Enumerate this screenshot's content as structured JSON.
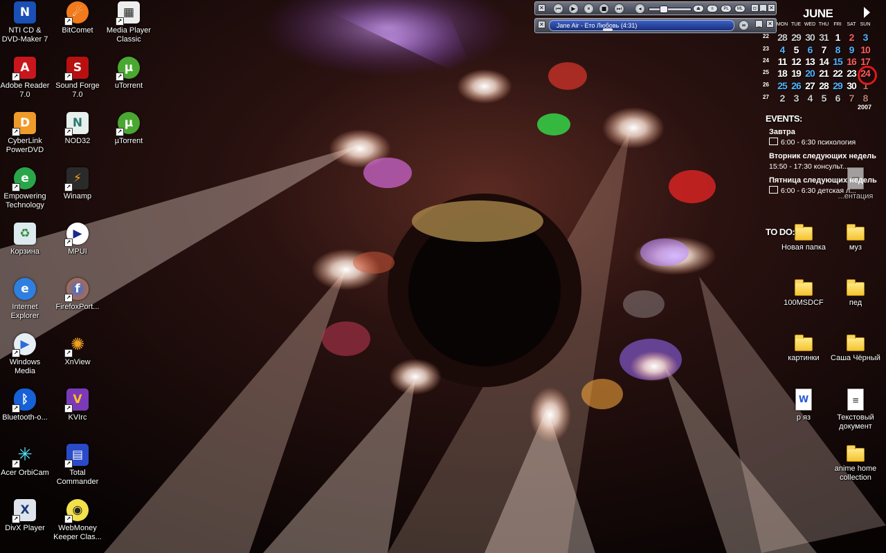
{
  "desktop": {
    "icons_left": [
      {
        "label": "NTI CD & DVD-Maker 7",
        "icon": "nti-icon"
      },
      {
        "label": "Adobe Reader 7.0",
        "icon": "adobe-reader-icon"
      },
      {
        "label": "CyberLink PowerDVD",
        "icon": "powerdvd-icon"
      },
      {
        "label": "Empowering Technology",
        "icon": "empowering-icon"
      },
      {
        "label": "Корзина",
        "icon": "recycle-bin-icon"
      },
      {
        "label": "Internet Explorer",
        "icon": "internet-explorer-icon"
      },
      {
        "label": "Windows Media",
        "icon": "windows-media-icon"
      },
      {
        "label": "Bluetooth-о...",
        "icon": "bluetooth-icon"
      },
      {
        "label": "Acer OrbiCam",
        "icon": "orbicam-icon"
      },
      {
        "label": "DivX Player",
        "icon": "divx-icon"
      }
    ],
    "icons_mid": [
      {
        "label": "BitComet",
        "icon": "bitcomet-icon"
      },
      {
        "label": "Sound Forge 7.0",
        "icon": "sound-forge-icon"
      },
      {
        "label": "NOD32",
        "icon": "nod32-icon"
      },
      {
        "label": "Winamp",
        "icon": "winamp-icon"
      },
      {
        "label": "MPUI",
        "icon": "mpui-icon"
      },
      {
        "label": "FirefoxPort...",
        "icon": "firefox-icon"
      },
      {
        "label": "XnView",
        "icon": "xnview-icon"
      },
      {
        "label": "KVIrc",
        "icon": "kvirc-icon"
      },
      {
        "label": "Total Commander",
        "icon": "total-commander-icon"
      },
      {
        "label": "WebMoney Keeper Clas...",
        "icon": "webmoney-icon"
      }
    ],
    "icons_third": [
      {
        "label": "Media Player Classic",
        "icon": "media-player-classic-icon"
      },
      {
        "label": "uTorrent",
        "icon": "utorrent-icon"
      },
      {
        "label": "µTorrent",
        "icon": "utorrent-icon"
      }
    ],
    "icons_right": [
      {
        "label": "Новая папка",
        "icon": "folder-icon"
      },
      {
        "label": "муз",
        "icon": "folder-icon"
      },
      {
        "label": "100MSDCF",
        "icon": "folder-icon"
      },
      {
        "label": "пед",
        "icon": "folder-icon"
      },
      {
        "label": "картинки",
        "icon": "folder-icon"
      },
      {
        "label": "Саша Чёрный",
        "icon": "folder-icon"
      },
      {
        "label": "р яз",
        "icon": "word-document-icon"
      },
      {
        "label": "Текстовый документ",
        "icon": "text-document-icon"
      },
      {
        "label": "anime home collection",
        "icon": "folder-icon"
      },
      {
        "label": "...ентация",
        "icon": "presentation-icon"
      }
    ]
  },
  "winamp": {
    "track": "Jane Air - Ето Любовь (4:31)",
    "pill_pl": "PL",
    "pill_ml": "ML",
    "accent": "#2b47a8"
  },
  "calendar": {
    "month": "JUNE",
    "year": "2007",
    "days_of_week": [
      "MON",
      "TUE",
      "WED",
      "THU",
      "FRI",
      "SAT",
      "SUN"
    ],
    "weeks": [
      {
        "num": "22",
        "days": [
          "28",
          "29",
          "30",
          "31",
          "1",
          "2",
          "3"
        ]
      },
      {
        "num": "23",
        "days": [
          "4",
          "5",
          "6",
          "7",
          "8",
          "9",
          "10"
        ]
      },
      {
        "num": "24",
        "days": [
          "11",
          "12",
          "13",
          "14",
          "15",
          "16",
          "17"
        ]
      },
      {
        "num": "25",
        "days": [
          "18",
          "19",
          "20",
          "21",
          "22",
          "23",
          "24"
        ]
      },
      {
        "num": "26",
        "days": [
          "25",
          "26",
          "27",
          "28",
          "29",
          "30",
          "1"
        ]
      },
      {
        "num": "27",
        "days": [
          "2",
          "3",
          "4",
          "5",
          "6",
          "7",
          "8"
        ]
      }
    ],
    "today": "24",
    "today_color": "#e01818"
  },
  "events": {
    "title": "EVENTS:",
    "items": [
      {
        "day": "Завтра",
        "line": "6:00 - 6:30 психология"
      },
      {
        "day": "Вторник следующих недель",
        "line": "15:50 - 17:30 консульт..."
      },
      {
        "day": "Пятница следующих недель",
        "line": "6:00 - 6:30 детская л..."
      }
    ],
    "todo_title": "TO DO:"
  }
}
